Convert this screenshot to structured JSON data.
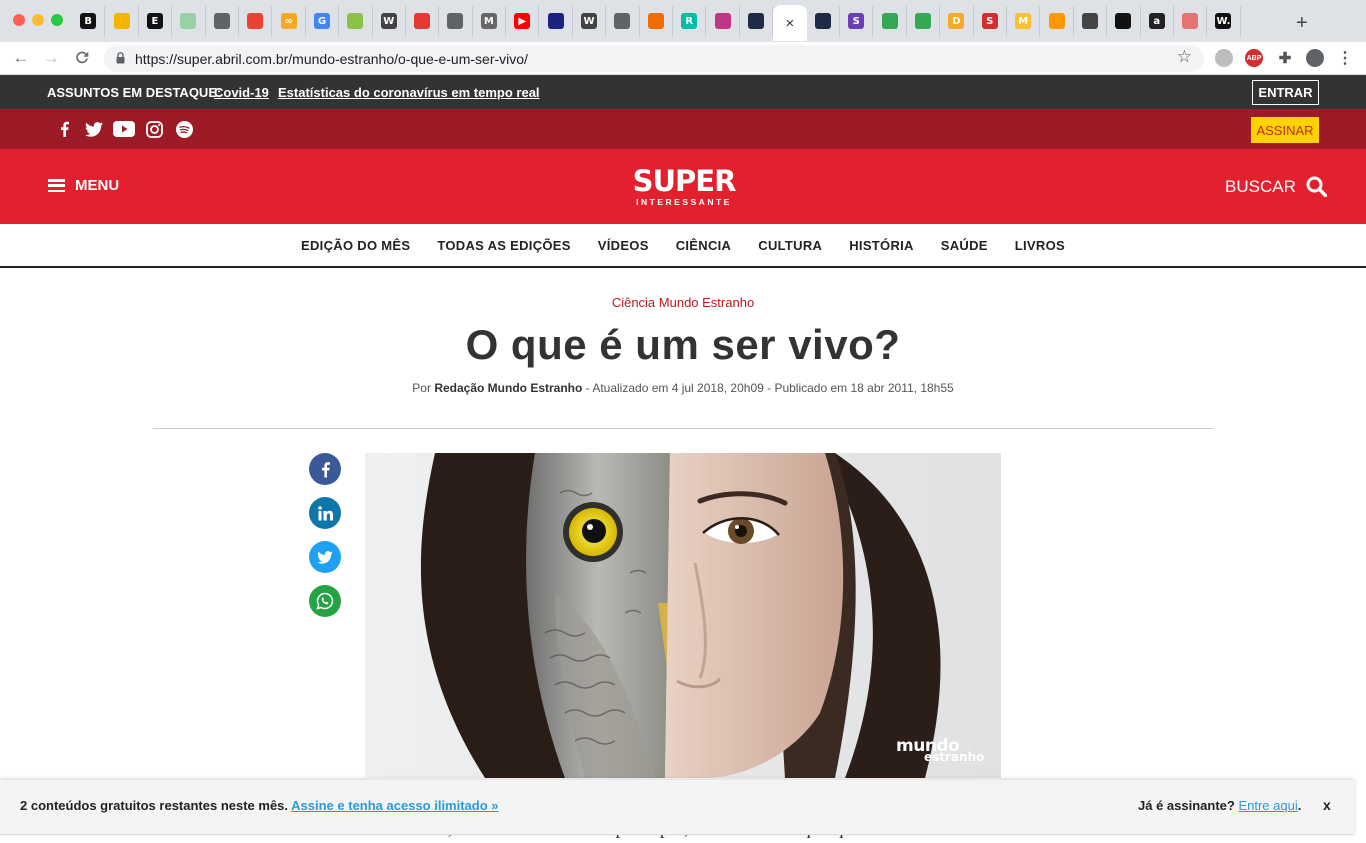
{
  "browser": {
    "url": "https://super.abril.com.br/mundo-estranho/o-que-e-um-ser-vivo/",
    "tab_favicons": [
      {
        "icon": "b-icon",
        "glyph": "B",
        "color": "#111111"
      },
      {
        "icon": "slides-icon",
        "glyph": "",
        "color": "#f4b400"
      },
      {
        "icon": "e-icon",
        "glyph": "E",
        "color": "#111111"
      },
      {
        "icon": "sheet-icon",
        "glyph": "",
        "color": "#9ad1a4"
      },
      {
        "icon": "globe-icon",
        "glyph": "",
        "color": "#5f6368"
      },
      {
        "icon": "ring-icon",
        "glyph": "",
        "color": "#ea4335"
      },
      {
        "icon": "infinity-icon",
        "glyph": "∞",
        "color": "#f9a825"
      },
      {
        "icon": "google-icon",
        "glyph": "G",
        "color": "#4285f4"
      },
      {
        "icon": "ebook-icon",
        "glyph": "",
        "color": "#8bc34a"
      },
      {
        "icon": "wikipedia-icon",
        "glyph": "W",
        "color": "#444444"
      },
      {
        "icon": "bookmark-icon",
        "glyph": "",
        "color": "#e53935"
      },
      {
        "icon": "globe-icon",
        "glyph": "",
        "color": "#5f6368"
      },
      {
        "icon": "medium-icon",
        "glyph": "M",
        "color": "#666666"
      },
      {
        "icon": "youtube-icon",
        "glyph": "▶",
        "color": "#ff0000"
      },
      {
        "icon": "circle-icon",
        "glyph": "",
        "color": "#1a237e"
      },
      {
        "icon": "wikipedia-icon",
        "glyph": "W",
        "color": "#444444"
      },
      {
        "icon": "globe-icon",
        "glyph": "",
        "color": "#5f6368"
      },
      {
        "icon": "frame-icon",
        "glyph": "",
        "color": "#ef6c00"
      },
      {
        "icon": "rg-icon",
        "glyph": "R",
        "color": "#00bfa5"
      },
      {
        "icon": "instagram-icon",
        "glyph": "",
        "color": "#c13584"
      },
      {
        "icon": "bird-icon",
        "glyph": "",
        "color": "#1f2a44"
      },
      {
        "icon": "bird-icon",
        "glyph": "",
        "color": "#1f2a44"
      },
      {
        "icon": "bird-icon",
        "glyph": "",
        "color": "#1f2a44"
      },
      {
        "icon": "s-icon",
        "glyph": "S",
        "color": "#6a3fb5"
      },
      {
        "icon": "drive-icon",
        "glyph": "",
        "color": "#34a853"
      },
      {
        "icon": "drive-icon",
        "glyph": "",
        "color": "#34a853"
      },
      {
        "icon": "d-icon",
        "glyph": "D",
        "color": "#f9a825"
      },
      {
        "icon": "s-red-icon",
        "glyph": "S",
        "color": "#d32f2f"
      },
      {
        "icon": "m-icon",
        "glyph": "M",
        "color": "#fbc02d"
      },
      {
        "icon": "grid-icon",
        "glyph": "",
        "color": "#ff9800"
      },
      {
        "icon": "diamond-icon",
        "glyph": "",
        "color": "#444444"
      },
      {
        "icon": "black-circle-icon",
        "glyph": "",
        "color": "#111111"
      },
      {
        "icon": "amazon-icon",
        "glyph": "a",
        "color": "#222222"
      },
      {
        "icon": "target-icon",
        "glyph": "",
        "color": "#e57373"
      },
      {
        "icon": "w-icon",
        "glyph": "W.",
        "color": "#111111"
      }
    ],
    "active_tab_index": 21
  },
  "topics": {
    "label": "ASSUNTOS EM DESTAQUE:",
    "links": [
      "Covid-19",
      "Estatísticas do coronavírus em tempo real"
    ],
    "login_label": "ENTRAR"
  },
  "social_bar": {
    "icons": [
      "facebook-icon",
      "twitter-icon",
      "youtube-icon",
      "instagram-icon",
      "spotify-icon"
    ],
    "subscribe_label": "ASSINAR"
  },
  "header": {
    "menu_label": "MENU",
    "logo_main": "SUPER",
    "logo_sub": "INTERESSANTE",
    "search_label": "BUSCAR"
  },
  "nav": {
    "items": [
      "EDIÇÃO DO MÊS",
      "TODAS AS EDIÇÕES",
      "VÍDEOS",
      "CIÊNCIA",
      "CULTURA",
      "HISTÓRIA",
      "SAÚDE",
      "LIVROS"
    ]
  },
  "article": {
    "kicker": "Ciência Mundo Estranho",
    "title": "O que é um ser vivo?",
    "byline_prefix": "Por",
    "author": "Redação Mundo Estranho",
    "byline_rest": " - Atualizado em 4 jul 2018, 20h09 - Publicado em 18 abr 2011, 18h55",
    "image_watermark_1": "mundo",
    "image_watermark_2": "estranho",
    "body_snippet": "Eu mesmo, não se entendendo a princípio, um ser vivo é qualquer coisa"
  },
  "share_buttons": [
    {
      "name": "facebook",
      "color": "#3b5998"
    },
    {
      "name": "linkedin",
      "color": "#0e76a8"
    },
    {
      "name": "twitter",
      "color": "#1da1f2"
    },
    {
      "name": "whatsapp",
      "color": "#25a244"
    }
  ],
  "paywall": {
    "text": "2 conteúdos gratuitos restantes neste mês. ",
    "link": "Assine e tenha acesso ilimitado »",
    "subscriber_text": "Já é assinante? ",
    "subscriber_link": "Entre aqui",
    "subscriber_end": ".",
    "close_label": "x"
  }
}
